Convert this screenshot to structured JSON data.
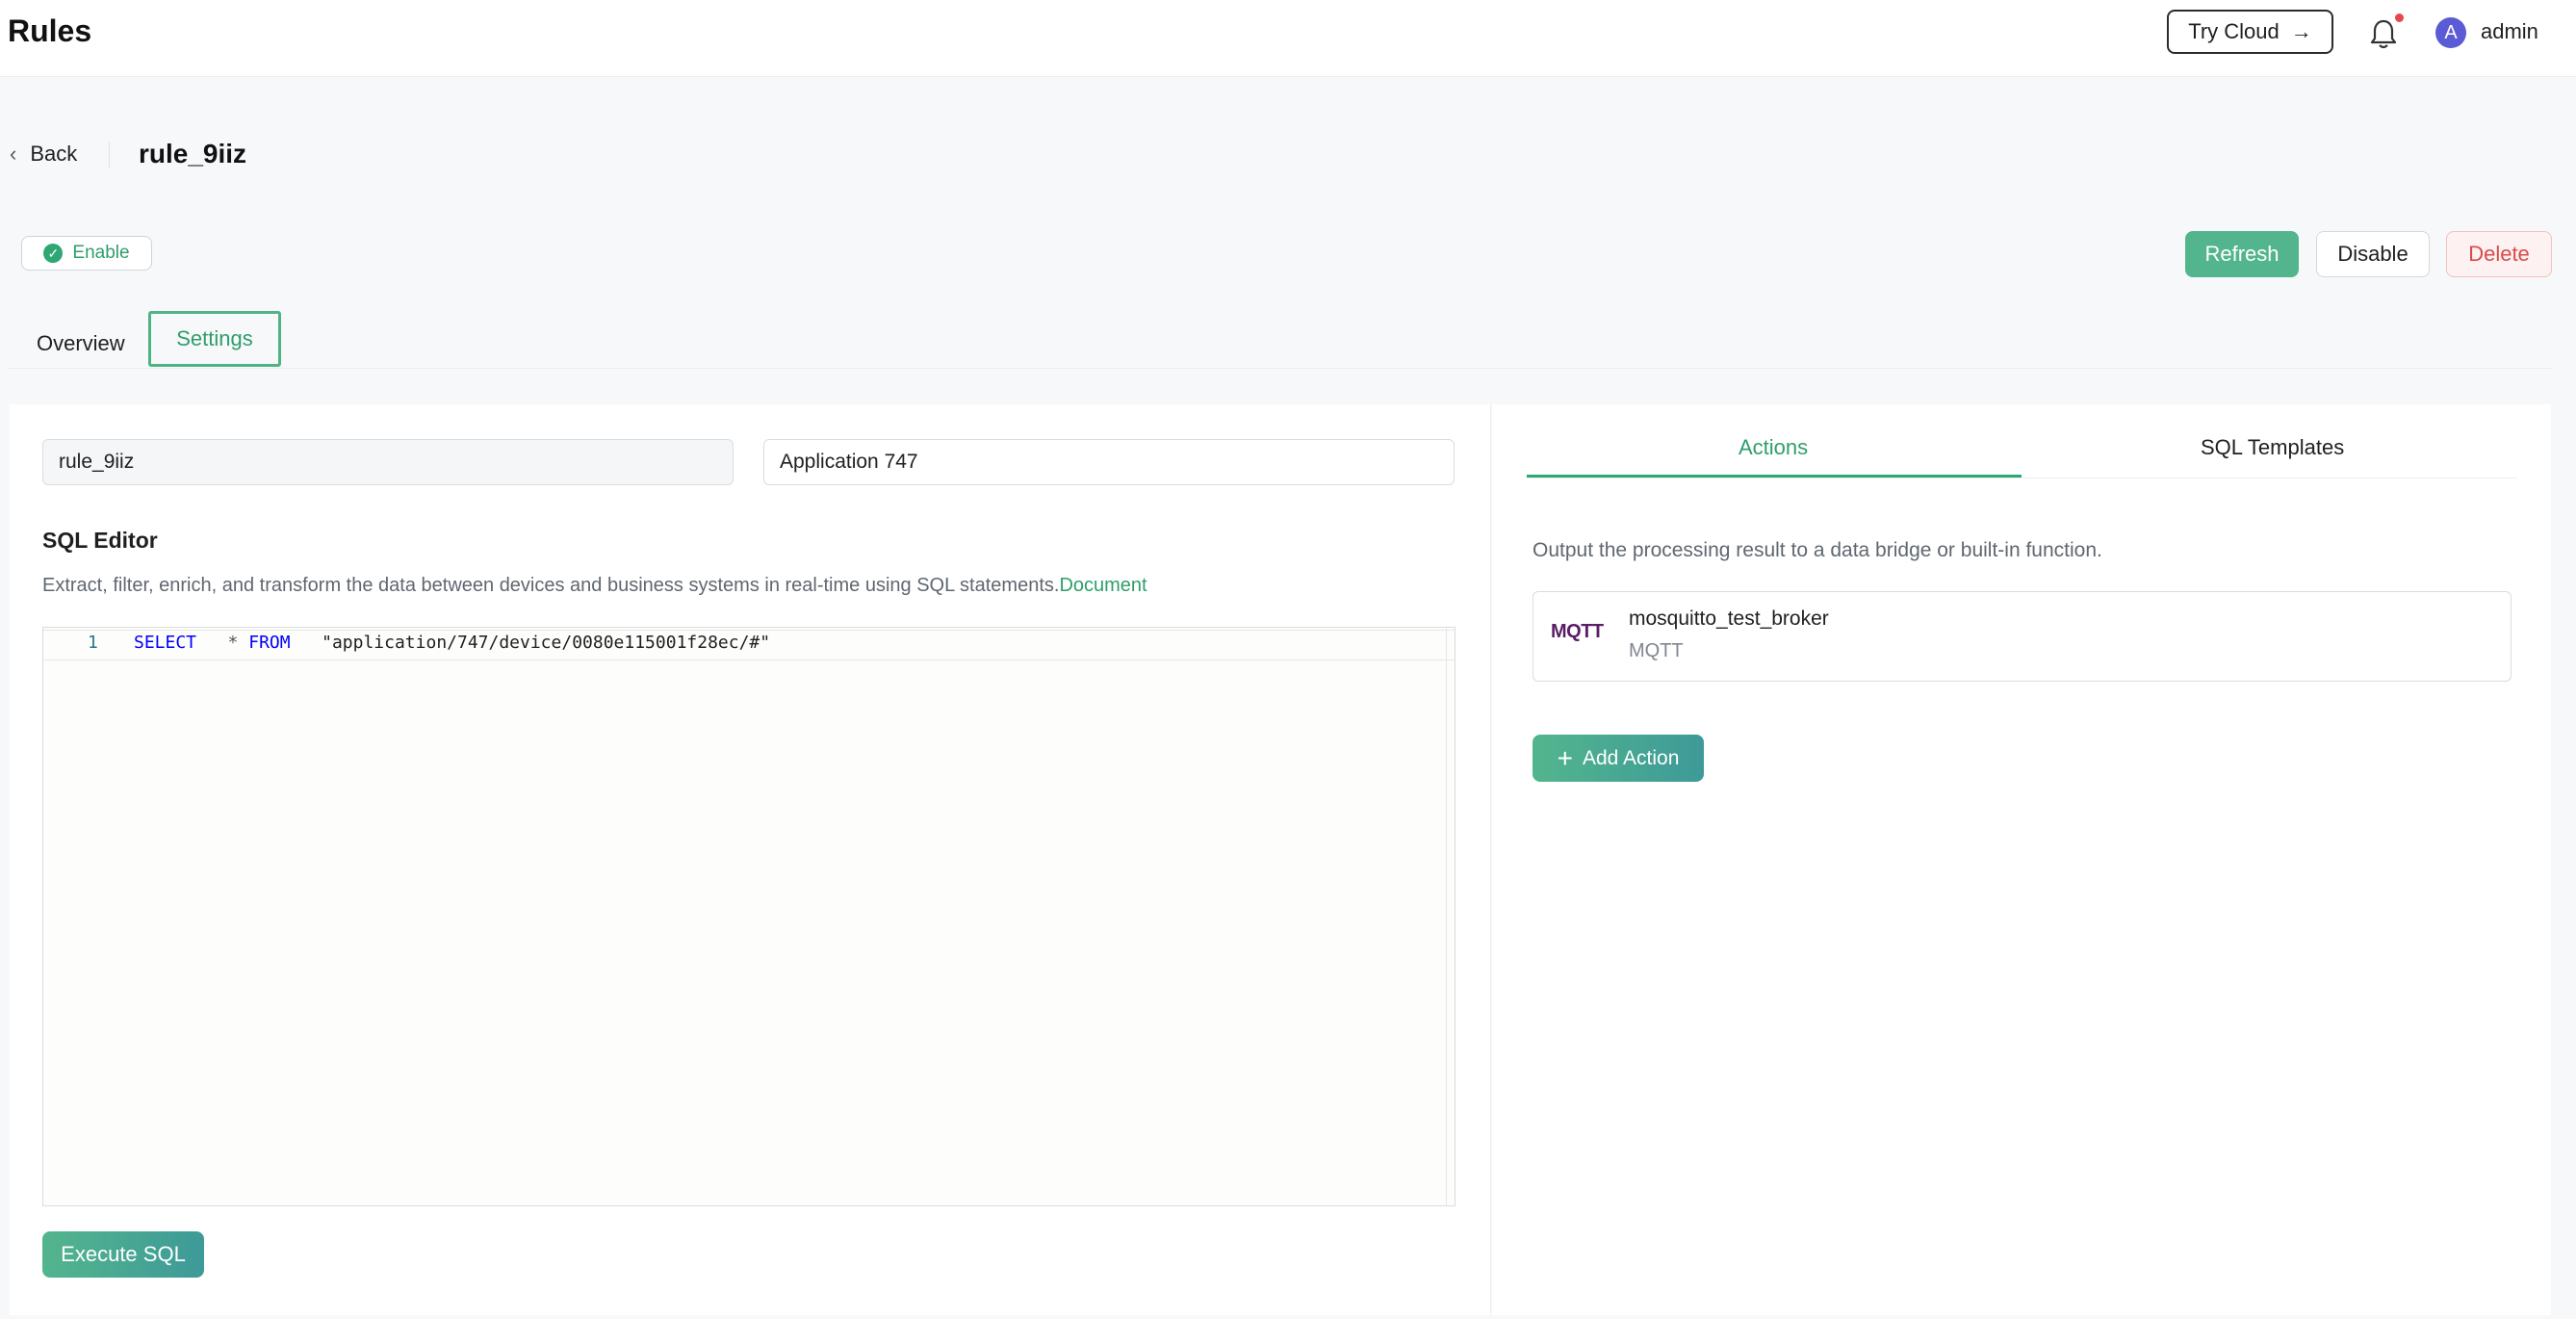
{
  "header": {
    "title": "Rules",
    "try_cloud": "Try Cloud",
    "avatar_letter": "A",
    "username": "admin"
  },
  "subheader": {
    "back_label": "Back",
    "rule_id": "rule_9iiz",
    "status": "Enable",
    "buttons": {
      "refresh": "Refresh",
      "disable": "Disable",
      "delete": "Delete"
    }
  },
  "tabs": [
    {
      "label": "Overview",
      "active": false
    },
    {
      "label": "Settings",
      "active": true
    }
  ],
  "form": {
    "name": "rule_9iiz",
    "description": "Application 747"
  },
  "sql_editor": {
    "title": "SQL Editor",
    "description": "Extract, filter, enrich, and transform the data between devices and business systems in real-time using SQL statements.",
    "doc_link": "Document",
    "lines": [
      {
        "number": "1",
        "select": "SELECT",
        "star": "*",
        "from": "FROM",
        "topic": "\"application/747/device/0080e115001f28ec/#\""
      }
    ],
    "execute_label": "Execute SQL"
  },
  "right_panel": {
    "tabs": [
      {
        "label": "Actions",
        "active": true
      },
      {
        "label": "SQL Templates",
        "active": false
      }
    ],
    "output_description": "Output the processing result to a data bridge or built-in function.",
    "actions": [
      {
        "logo": "MQTT",
        "name": "mosquitto_test_broker",
        "type": "MQTT"
      }
    ],
    "add_action_label": "Add Action"
  },
  "colors": {
    "accent": "#2ea773",
    "danger": "#d94a4a",
    "avatar": "#5b5bd6"
  },
  "icons": [
    "arrow-right-icon",
    "bell-icon",
    "chevron-left-icon",
    "check-circle-icon",
    "plus-icon"
  ]
}
